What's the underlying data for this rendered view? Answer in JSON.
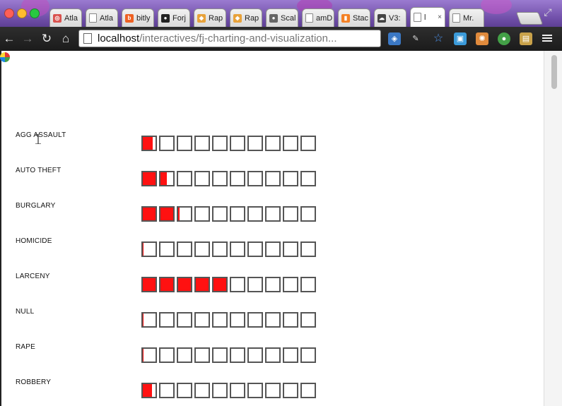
{
  "browser": {
    "tabs": [
      {
        "title": "Atla",
        "icon": "atlassian-icon"
      },
      {
        "title": "Atla",
        "icon": "page-icon"
      },
      {
        "title": "bitly",
        "icon": "bitly-icon"
      },
      {
        "title": "Forj",
        "icon": "github-icon"
      },
      {
        "title": "Rap",
        "icon": "rapportive-icon"
      },
      {
        "title": "Rap",
        "icon": "rapportive-icon"
      },
      {
        "title": "Scal",
        "icon": "circle-icon"
      },
      {
        "title": "amD",
        "icon": "page-icon"
      },
      {
        "title": "Stac",
        "icon": "stack-icon"
      },
      {
        "title": "V3:",
        "icon": "cloud-icon"
      },
      {
        "title": "l",
        "icon": "page-icon",
        "active": true
      },
      {
        "title": "Mr.",
        "icon": "page-icon"
      }
    ],
    "address": {
      "host": "localhost",
      "path": "/interactives/fj-charting-and-visualization..."
    }
  },
  "chart_data": {
    "type": "bar",
    "max_boxes": 10,
    "categories": [
      "AGG ASSAULT",
      "AUTO THEFT",
      "BURGLARY",
      "HOMICIDE",
      "LARCENY",
      "NULL",
      "RAPE",
      "ROBBERY"
    ],
    "values": [
      0.75,
      1.5,
      2.1,
      0.05,
      5.0,
      0.05,
      0.05,
      0.7
    ],
    "colors": {
      "fill": "#ff1111",
      "box_border": "#555555"
    }
  }
}
